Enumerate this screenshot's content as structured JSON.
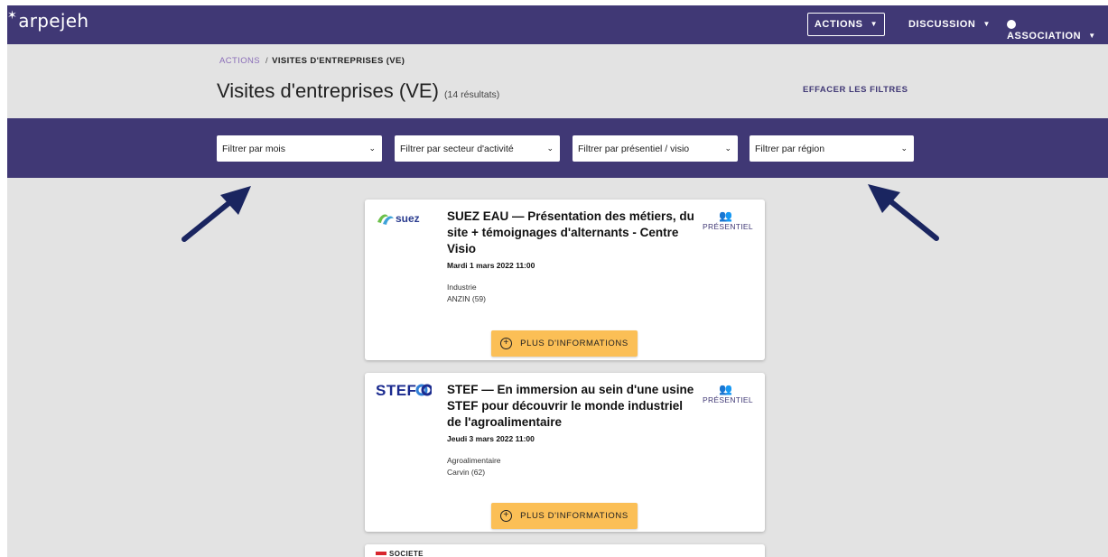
{
  "nav": {
    "logo": "arpejeh",
    "actions": "ACTIONS",
    "discussion": "DISCUSSION",
    "association": "ASSOCIATION"
  },
  "breadcrumb": {
    "parent": "ACTIONS",
    "separator": "/",
    "current": "VISITES D'ENTREPRISES (VE)"
  },
  "page": {
    "title": "Visites d'entreprises (VE)",
    "count": "(14 résultats)",
    "clear_filters": "EFFACER LES FILTRES"
  },
  "filters": [
    {
      "label": "Filtrer par mois"
    },
    {
      "label": "Filtrer par secteur d'activité"
    },
    {
      "label": "Filtrer par présentiel / visio"
    },
    {
      "label": "Filtrer par région"
    }
  ],
  "cards": [
    {
      "company_logo": "suez",
      "title": "SUEZ EAU  — Présentation des métiers, du site + témoignages d'alternants - Centre Visio",
      "date": "Mardi 1 mars 2022 11:00",
      "sector": "Industrie",
      "location": "ANZIN (59)",
      "mode": "PRÉSENTIEL",
      "button": "PLUS D'INFORMATIONS"
    },
    {
      "company_logo": "STEF",
      "title": "STEF  — En immersion au sein d'une usine STEF pour découvrir le monde industriel de l'agroalimentaire",
      "date": "Jeudi 3 mars 2022 11:00",
      "sector": "Agroalimentaire",
      "location": "Carvin (62)",
      "mode": "PRÉSENTIEL",
      "button": "PLUS D'INFORMATIONS"
    },
    {
      "company_logo": "SOCIETE"
    }
  ],
  "colors": {
    "brand": "#403875",
    "button": "#fbbf56",
    "background": "#e3e3e3",
    "arrow": "#1a2560"
  }
}
